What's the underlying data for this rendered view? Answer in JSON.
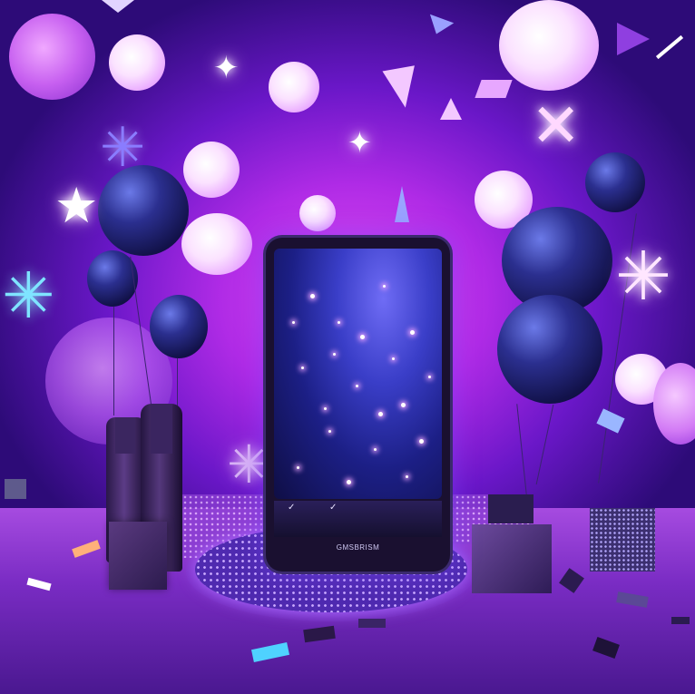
{
  "scene": {
    "phone": {
      "brand_text": "GMSBRISM",
      "check_left": "✓",
      "check_mid": "✓"
    }
  },
  "colors": {
    "background_center": "#e04ef0",
    "background_edge": "#2d0b78",
    "balloon_dark": "#12124a",
    "orb_light": "#fbe2ff",
    "screen": "#1c1f86"
  }
}
